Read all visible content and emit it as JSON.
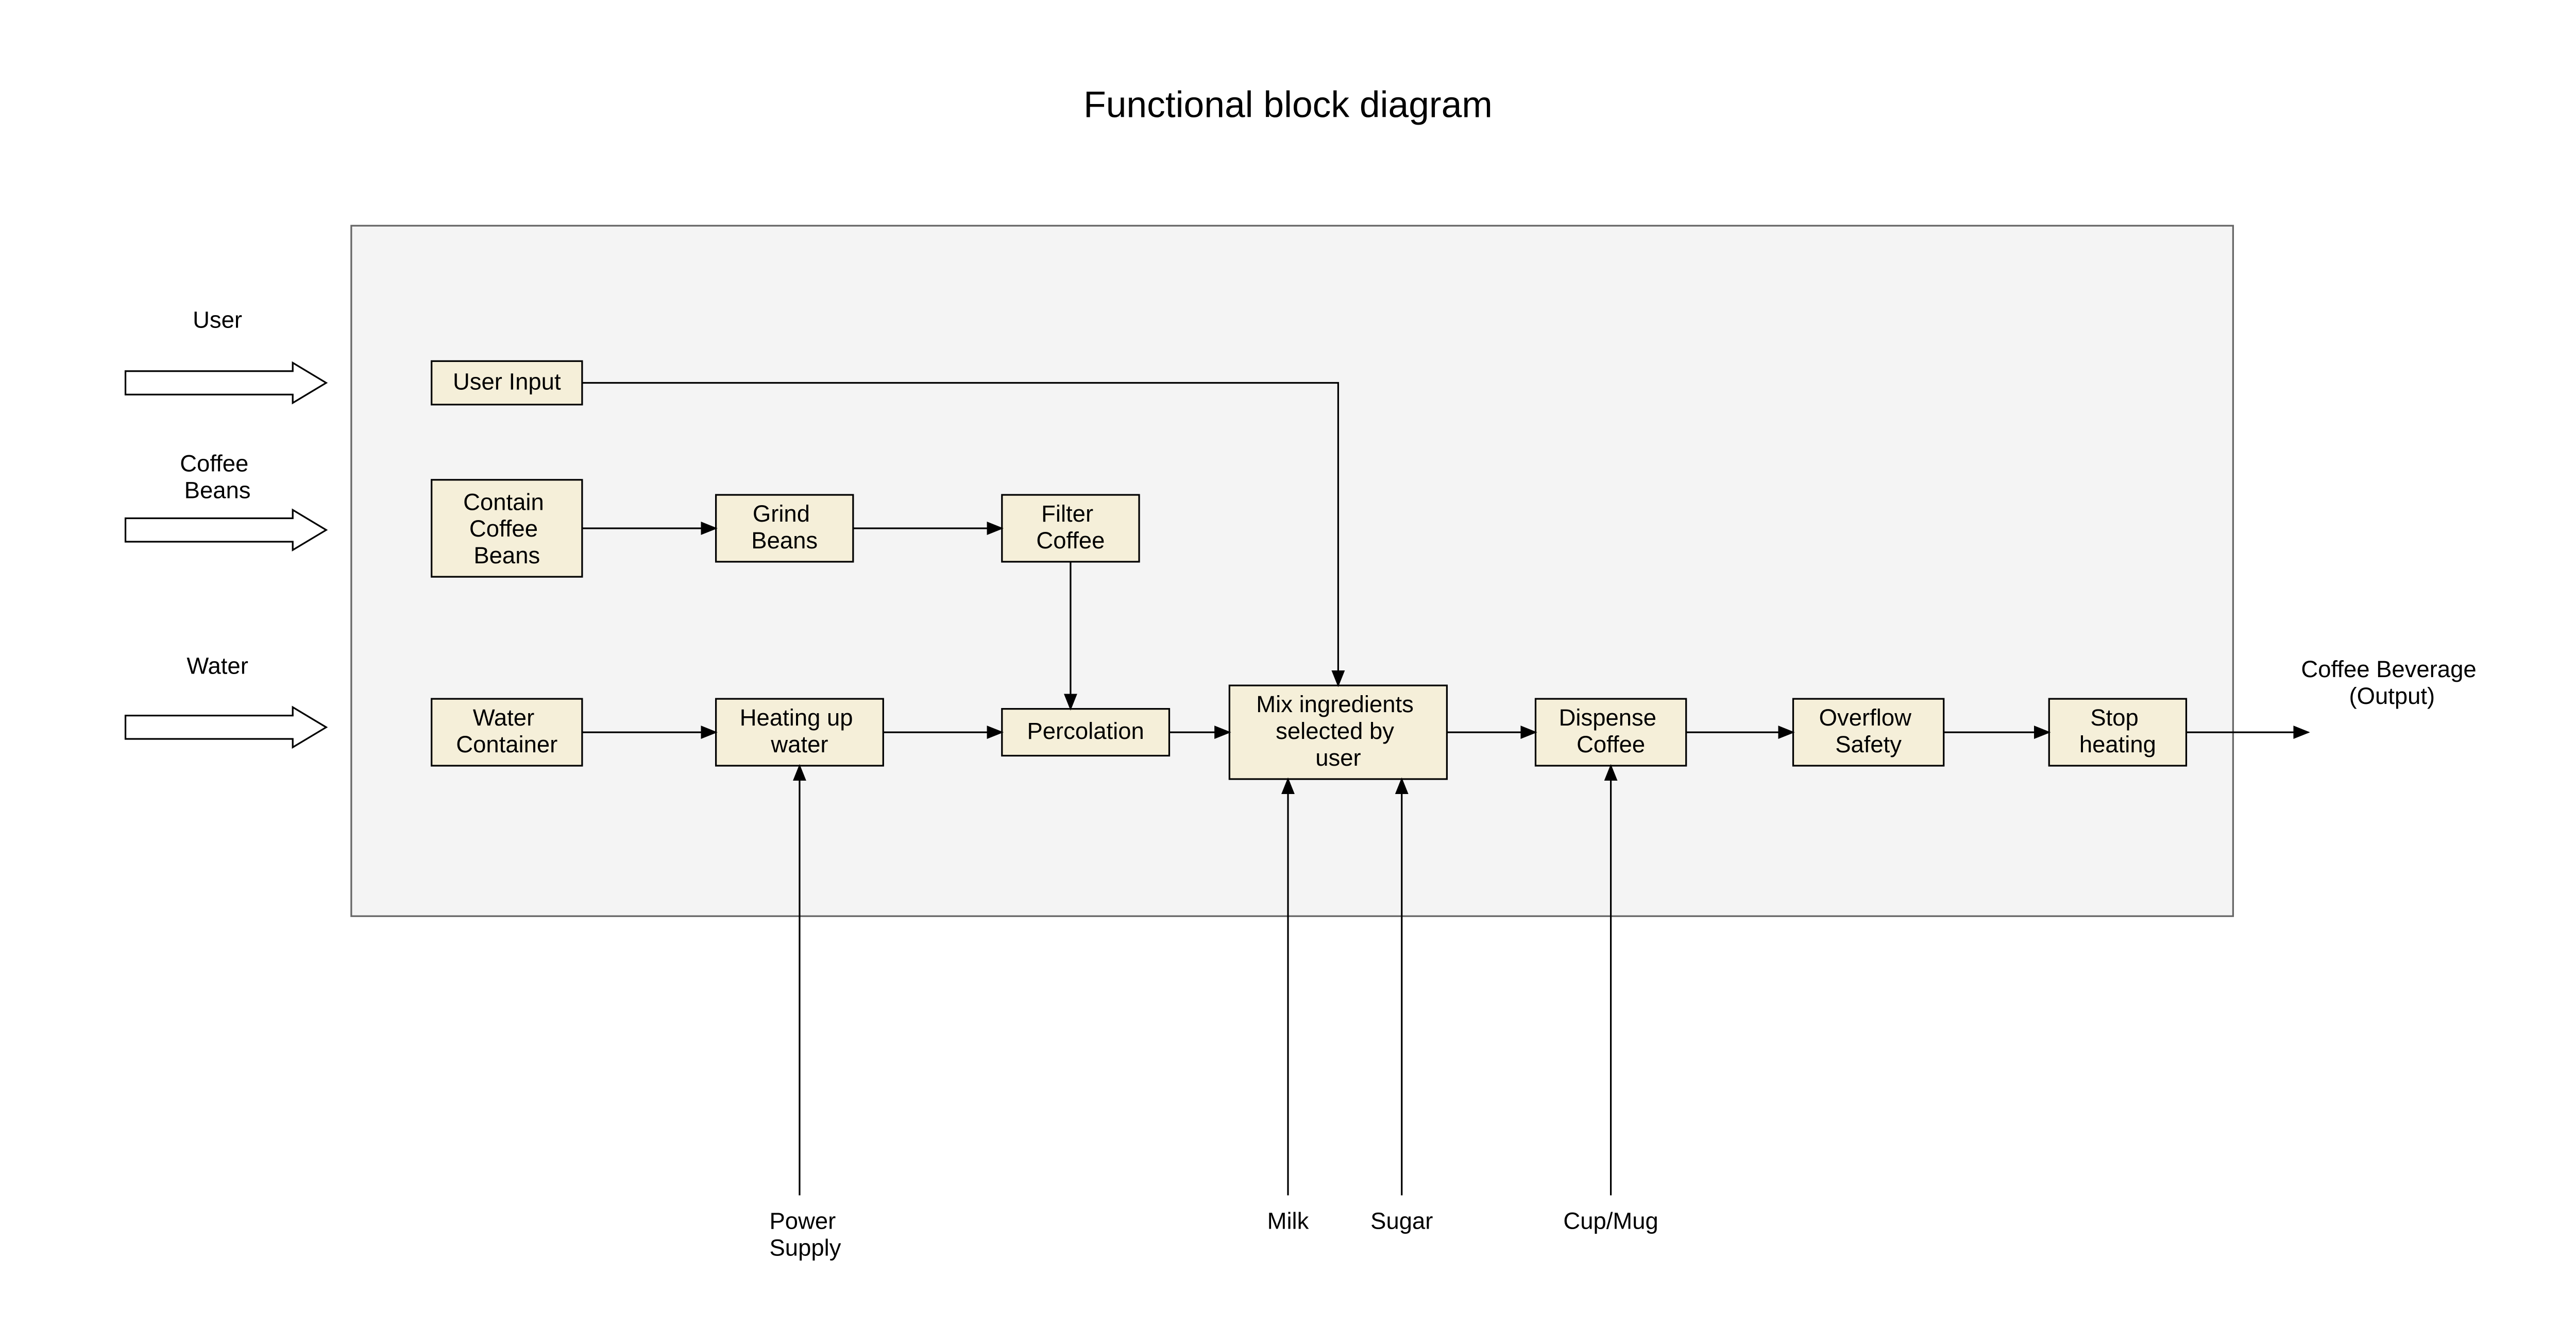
{
  "title": "Functional block diagram",
  "inputs": {
    "user": "User",
    "coffee_beans": "Coffee\nBeans",
    "water": "Water",
    "power": "Power\nSupply",
    "milk": "Milk",
    "sugar": "Sugar",
    "cup": "Cup/Mug"
  },
  "blocks": {
    "user_input": "User Input",
    "contain": "Contain\nCoffee\nBeans",
    "grind": "Grind\nBeans",
    "filter": "Filter\nCoffee",
    "water_container": "Water\nContainer",
    "heating": "Heating up\nwater",
    "percolation": "Percolation",
    "mix": "Mix ingredients\nselected by\nuser",
    "dispense": "Dispense\nCoffee",
    "overflow": "Overflow\nSafety",
    "stop": "Stop\nheating"
  },
  "output": "Coffee Beverage\n(Output)"
}
